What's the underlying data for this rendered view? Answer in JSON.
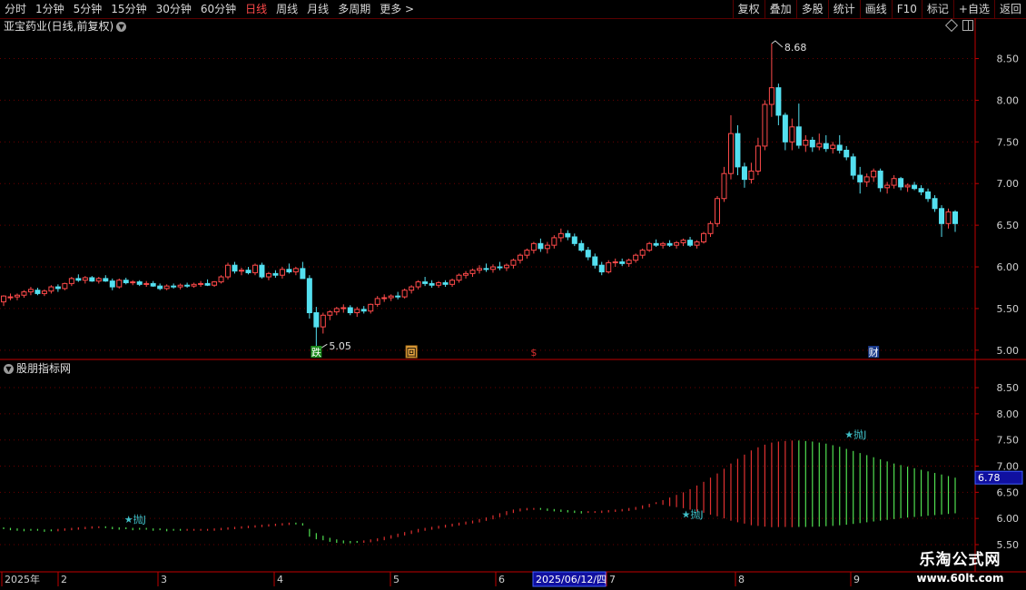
{
  "toolbar": {
    "periods": [
      {
        "label": "分时",
        "active": false
      },
      {
        "label": "1分钟",
        "active": false
      },
      {
        "label": "5分钟",
        "active": false
      },
      {
        "label": "15分钟",
        "active": false
      },
      {
        "label": "30分钟",
        "active": false
      },
      {
        "label": "60分钟",
        "active": false
      },
      {
        "label": "日线",
        "active": true
      },
      {
        "label": "周线",
        "active": false
      },
      {
        "label": "月线",
        "active": false
      },
      {
        "label": "多周期",
        "active": false
      },
      {
        "label": "更多 >",
        "active": false
      }
    ],
    "buttons": [
      "复权",
      "叠加",
      "多股",
      "统计",
      "画线",
      "F10",
      "标记",
      "+自选",
      "返回"
    ]
  },
  "main_chart": {
    "title": "亚宝药业(日线,前复权)",
    "y_ticks": [
      "8.50",
      "8.00",
      "7.50",
      "7.00",
      "6.50",
      "6.00",
      "5.50",
      "5.00"
    ],
    "high_label": "8.68",
    "low_label": "5.05",
    "markers": [
      "跌",
      "回",
      "$",
      "财"
    ]
  },
  "sub_chart": {
    "title": "股朋指标网",
    "y_ticks": [
      "8.50",
      "8.00",
      "7.50",
      "7.00",
      "6.50",
      "6.00",
      "5.50"
    ],
    "current_value": "6.78",
    "signals": [
      "抛J",
      "抛J",
      "抛J"
    ]
  },
  "x_axis": {
    "labels": [
      "2025年",
      "2",
      "3",
      "4",
      "5",
      "6",
      "7",
      "8",
      "9"
    ],
    "cursor_date": "2025/06/12/四"
  },
  "watermark": {
    "name": "乐淘公式网",
    "url": "www.60lt.com"
  },
  "colors": {
    "up": "#ff4a4a",
    "down": "#54e0f0",
    "grid": "#6a0000",
    "frame": "#c00000",
    "sub_up": "#e03030",
    "sub_down": "#50e050"
  },
  "chart_data": [
    {
      "type": "candlestick",
      "title": "亚宝药业(日线,前复权)",
      "ylim": [
        4.9,
        8.8
      ],
      "x_labels": [
        "2025年",
        "2",
        "3",
        "4",
        "5",
        "6",
        "7",
        "8",
        "9"
      ],
      "ohlc": [
        [
          5.58,
          5.66,
          5.53,
          5.65
        ],
        [
          5.63,
          5.68,
          5.6,
          5.64
        ],
        [
          5.64,
          5.68,
          5.6,
          5.66
        ],
        [
          5.66,
          5.72,
          5.63,
          5.7
        ],
        [
          5.7,
          5.76,
          5.66,
          5.73
        ],
        [
          5.72,
          5.75,
          5.66,
          5.68
        ],
        [
          5.68,
          5.73,
          5.65,
          5.71
        ],
        [
          5.71,
          5.78,
          5.68,
          5.76
        ],
        [
          5.76,
          5.79,
          5.7,
          5.74
        ],
        [
          5.74,
          5.81,
          5.72,
          5.8
        ],
        [
          5.8,
          5.88,
          5.77,
          5.86
        ],
        [
          5.86,
          5.91,
          5.82,
          5.84
        ],
        [
          5.84,
          5.89,
          5.8,
          5.87
        ],
        [
          5.87,
          5.89,
          5.82,
          5.83
        ],
        [
          5.83,
          5.88,
          5.8,
          5.86
        ],
        [
          5.86,
          5.9,
          5.82,
          5.83
        ],
        [
          5.83,
          5.86,
          5.72,
          5.76
        ],
        [
          5.76,
          5.86,
          5.74,
          5.84
        ],
        [
          5.84,
          5.87,
          5.79,
          5.81
        ],
        [
          5.81,
          5.84,
          5.78,
          5.82
        ],
        [
          5.82,
          5.84,
          5.77,
          5.79
        ],
        [
          5.79,
          5.83,
          5.76,
          5.8
        ],
        [
          5.8,
          5.83,
          5.76,
          5.77
        ],
        [
          5.77,
          5.8,
          5.72,
          5.74
        ],
        [
          5.74,
          5.79,
          5.72,
          5.77
        ],
        [
          5.77,
          5.8,
          5.74,
          5.76
        ],
        [
          5.76,
          5.8,
          5.73,
          5.78
        ],
        [
          5.78,
          5.81,
          5.75,
          5.77
        ],
        [
          5.77,
          5.81,
          5.75,
          5.79
        ],
        [
          5.79,
          5.83,
          5.76,
          5.8
        ],
        [
          5.8,
          5.85,
          5.77,
          5.78
        ],
        [
          5.78,
          5.83,
          5.76,
          5.82
        ],
        [
          5.82,
          5.9,
          5.8,
          5.88
        ],
        [
          5.88,
          6.05,
          5.85,
          6.02
        ],
        [
          6.02,
          6.06,
          5.92,
          5.95
        ],
        [
          5.95,
          5.99,
          5.9,
          5.96
        ],
        [
          5.96,
          6.0,
          5.91,
          5.93
        ],
        [
          5.93,
          6.04,
          5.9,
          6.02
        ],
        [
          6.02,
          6.05,
          5.86,
          5.88
        ],
        [
          5.88,
          5.94,
          5.84,
          5.92
        ],
        [
          5.92,
          5.96,
          5.87,
          5.9
        ],
        [
          5.9,
          6.0,
          5.86,
          5.97
        ],
        [
          5.97,
          6.04,
          5.92,
          5.94
        ],
        [
          5.94,
          6.0,
          5.9,
          5.98
        ],
        [
          5.98,
          6.06,
          5.93,
          5.86
        ],
        [
          5.86,
          5.9,
          5.38,
          5.45
        ],
        [
          5.45,
          5.52,
          5.05,
          5.28
        ],
        [
          5.28,
          5.45,
          5.2,
          5.42
        ],
        [
          5.42,
          5.48,
          5.36,
          5.46
        ],
        [
          5.46,
          5.52,
          5.42,
          5.5
        ],
        [
          5.5,
          5.55,
          5.45,
          5.51
        ],
        [
          5.51,
          5.54,
          5.42,
          5.45
        ],
        [
          5.45,
          5.52,
          5.4,
          5.49
        ],
        [
          5.49,
          5.53,
          5.44,
          5.47
        ],
        [
          5.47,
          5.56,
          5.44,
          5.55
        ],
        [
          5.55,
          5.65,
          5.52,
          5.62
        ],
        [
          5.62,
          5.67,
          5.58,
          5.63
        ],
        [
          5.63,
          5.67,
          5.59,
          5.65
        ],
        [
          5.65,
          5.7,
          5.61,
          5.64
        ],
        [
          5.64,
          5.74,
          5.62,
          5.72
        ],
        [
          5.72,
          5.78,
          5.68,
          5.76
        ],
        [
          5.76,
          5.84,
          5.73,
          5.82
        ],
        [
          5.82,
          5.88,
          5.77,
          5.8
        ],
        [
          5.8,
          5.84,
          5.75,
          5.78
        ],
        [
          5.78,
          5.83,
          5.75,
          5.81
        ],
        [
          5.81,
          5.84,
          5.76,
          5.79
        ],
        [
          5.79,
          5.86,
          5.76,
          5.84
        ],
        [
          5.84,
          5.92,
          5.81,
          5.9
        ],
        [
          5.9,
          5.95,
          5.86,
          5.92
        ],
        [
          5.92,
          5.98,
          5.88,
          5.96
        ],
        [
          5.96,
          6.02,
          5.92,
          5.98
        ],
        [
          5.98,
          6.04,
          5.94,
          5.97
        ],
        [
          5.97,
          6.03,
          5.93,
          6.0
        ],
        [
          6.0,
          6.06,
          5.96,
          5.99
        ],
        [
          5.99,
          6.04,
          5.95,
          6.02
        ],
        [
          6.02,
          6.1,
          5.98,
          6.08
        ],
        [
          6.08,
          6.16,
          6.04,
          6.14
        ],
        [
          6.14,
          6.22,
          6.1,
          6.2
        ],
        [
          6.2,
          6.3,
          6.16,
          6.28
        ],
        [
          6.28,
          6.34,
          6.18,
          6.22
        ],
        [
          6.22,
          6.3,
          6.16,
          6.26
        ],
        [
          6.26,
          6.38,
          6.22,
          6.35
        ],
        [
          6.35,
          6.46,
          6.3,
          6.4
        ],
        [
          6.4,
          6.44,
          6.32,
          6.36
        ],
        [
          6.36,
          6.4,
          6.25,
          6.28
        ],
        [
          6.28,
          6.32,
          6.18,
          6.2
        ],
        [
          6.2,
          6.24,
          6.08,
          6.12
        ],
        [
          6.12,
          6.16,
          5.98,
          6.02
        ],
        [
          6.02,
          6.06,
          5.9,
          5.94
        ],
        [
          5.94,
          6.08,
          5.92,
          6.05
        ],
        [
          6.05,
          6.1,
          6.0,
          6.06
        ],
        [
          6.06,
          6.1,
          6.01,
          6.04
        ],
        [
          6.04,
          6.1,
          6.0,
          6.08
        ],
        [
          6.08,
          6.16,
          6.05,
          6.14
        ],
        [
          6.14,
          6.22,
          6.1,
          6.2
        ],
        [
          6.2,
          6.3,
          6.18,
          6.28
        ],
        [
          6.28,
          6.33,
          6.24,
          6.26
        ],
        [
          6.26,
          6.3,
          6.22,
          6.28
        ],
        [
          6.28,
          6.32,
          6.24,
          6.26
        ],
        [
          6.26,
          6.31,
          6.22,
          6.29
        ],
        [
          6.29,
          6.34,
          6.25,
          6.32
        ],
        [
          6.32,
          6.36,
          6.24,
          6.26
        ],
        [
          6.26,
          6.32,
          6.22,
          6.3
        ],
        [
          6.3,
          6.42,
          6.28,
          6.4
        ],
        [
          6.4,
          6.55,
          6.36,
          6.52
        ],
        [
          6.52,
          6.85,
          6.48,
          6.82
        ],
        [
          6.82,
          7.2,
          6.78,
          7.12
        ],
        [
          7.12,
          7.82,
          7.05,
          7.6
        ],
        [
          7.6,
          7.7,
          7.1,
          7.2
        ],
        [
          7.2,
          7.25,
          6.95,
          7.05
        ],
        [
          7.05,
          7.25,
          7.0,
          7.15
        ],
        [
          7.15,
          7.55,
          7.1,
          7.45
        ],
        [
          7.45,
          8.0,
          7.4,
          7.95
        ],
        [
          7.95,
          8.68,
          7.8,
          8.15
        ],
        [
          8.15,
          8.2,
          7.7,
          7.82
        ],
        [
          7.82,
          7.85,
          7.4,
          7.5
        ],
        [
          7.5,
          7.78,
          7.4,
          7.68
        ],
        [
          7.68,
          7.96,
          7.42,
          7.46
        ],
        [
          7.46,
          7.58,
          7.38,
          7.52
        ],
        [
          7.52,
          7.56,
          7.38,
          7.44
        ],
        [
          7.44,
          7.6,
          7.4,
          7.48
        ],
        [
          7.48,
          7.58,
          7.38,
          7.42
        ],
        [
          7.42,
          7.5,
          7.36,
          7.46
        ],
        [
          7.46,
          7.58,
          7.36,
          7.4
        ],
        [
          7.4,
          7.45,
          7.28,
          7.32
        ],
        [
          7.32,
          7.36,
          7.05,
          7.1
        ],
        [
          7.1,
          7.2,
          6.88,
          7.02
        ],
        [
          7.02,
          7.12,
          6.96,
          7.08
        ],
        [
          7.08,
          7.18,
          7.02,
          7.15
        ],
        [
          7.15,
          7.18,
          6.9,
          6.95
        ],
        [
          6.95,
          7.02,
          6.88,
          6.98
        ],
        [
          6.98,
          7.1,
          6.94,
          7.06
        ],
        [
          7.06,
          7.08,
          6.92,
          6.96
        ],
        [
          6.96,
          7.0,
          6.9,
          6.98
        ],
        [
          6.98,
          7.02,
          6.92,
          6.94
        ],
        [
          6.94,
          6.98,
          6.86,
          6.9
        ],
        [
          6.9,
          6.94,
          6.78,
          6.82
        ],
        [
          6.82,
          6.86,
          6.66,
          6.7
        ],
        [
          6.7,
          6.74,
          6.36,
          6.52
        ],
        [
          6.52,
          6.7,
          6.46,
          6.66
        ],
        [
          6.66,
          6.68,
          6.42,
          6.52
        ]
      ]
    },
    {
      "type": "bar",
      "title": "股朋指标网",
      "ylim": [
        5.5,
        8.9
      ],
      "current_value": 6.78,
      "values": [
        5.83,
        5.82,
        5.81,
        5.8,
        5.8,
        5.8,
        5.79,
        5.79,
        5.8,
        5.81,
        5.82,
        5.83,
        5.84,
        5.85,
        5.85,
        5.85,
        5.84,
        5.83,
        5.83,
        5.82,
        5.82,
        5.82,
        5.81,
        5.81,
        5.8,
        5.8,
        5.8,
        5.8,
        5.8,
        5.8,
        5.8,
        5.81,
        5.82,
        5.83,
        5.84,
        5.85,
        5.86,
        5.87,
        5.88,
        5.89,
        5.9,
        5.91,
        5.92,
        5.92,
        5.91,
        5.8,
        5.72,
        5.67,
        5.63,
        5.6,
        5.58,
        5.57,
        5.57,
        5.58,
        5.6,
        5.62,
        5.65,
        5.68,
        5.71,
        5.74,
        5.77,
        5.8,
        5.82,
        5.84,
        5.86,
        5.88,
        5.9,
        5.92,
        5.94,
        5.96,
        5.99,
        6.02,
        6.06,
        6.1,
        6.14,
        6.17,
        6.19,
        6.2,
        6.2,
        6.2,
        6.19,
        6.18,
        6.17,
        6.16,
        6.15,
        6.14,
        6.14,
        6.14,
        6.15,
        6.16,
        6.17,
        6.18,
        6.2,
        6.22,
        6.25,
        6.28,
        6.31,
        6.35,
        6.4,
        6.45,
        6.5,
        6.56,
        6.63,
        6.7,
        6.78,
        6.86,
        6.95,
        7.05,
        7.14,
        7.22,
        7.3,
        7.36,
        7.41,
        7.45,
        7.47,
        7.48,
        7.49,
        7.49,
        7.48,
        7.47,
        7.45,
        7.43,
        7.4,
        7.37,
        7.33,
        7.29,
        7.25,
        7.21,
        7.17,
        7.13,
        7.09,
        7.05,
        7.02,
        6.99,
        6.96,
        6.93,
        6.9,
        6.87,
        6.84,
        6.81,
        6.78
      ],
      "colors": [
        "g",
        "g",
        "g",
        "g",
        "g",
        "g",
        "g",
        "g",
        "r",
        "r",
        "r",
        "r",
        "r",
        "r",
        "r",
        "g",
        "g",
        "g",
        "g",
        "g",
        "g",
        "g",
        "g",
        "g",
        "g",
        "g",
        "g",
        "r",
        "r",
        "r",
        "r",
        "r",
        "r",
        "r",
        "r",
        "r",
        "r",
        "r",
        "r",
        "r",
        "r",
        "r",
        "r",
        "g",
        "g",
        "g",
        "g",
        "g",
        "g",
        "g",
        "g",
        "g",
        "g",
        "r",
        "r",
        "r",
        "r",
        "r",
        "r",
        "r",
        "r",
        "r",
        "r",
        "r",
        "r",
        "r",
        "r",
        "r",
        "r",
        "r",
        "r",
        "r",
        "r",
        "r",
        "r",
        "r",
        "r",
        "r",
        "r",
        "g",
        "g",
        "g",
        "g",
        "g",
        "g",
        "g",
        "r",
        "r",
        "r",
        "r",
        "r",
        "r",
        "r",
        "r",
        "r",
        "r",
        "r",
        "r",
        "r",
        "r",
        "r",
        "r",
        "r",
        "r",
        "r",
        "r",
        "r",
        "r",
        "r",
        "r",
        "r",
        "r",
        "r",
        "r",
        "r",
        "r",
        "r",
        "g",
        "g",
        "g",
        "g",
        "g",
        "g",
        "g",
        "g",
        "g",
        "g",
        "g",
        "g",
        "g",
        "g",
        "g",
        "g",
        "g",
        "g",
        "g",
        "g",
        "g",
        "g",
        "g",
        "g"
      ]
    }
  ]
}
